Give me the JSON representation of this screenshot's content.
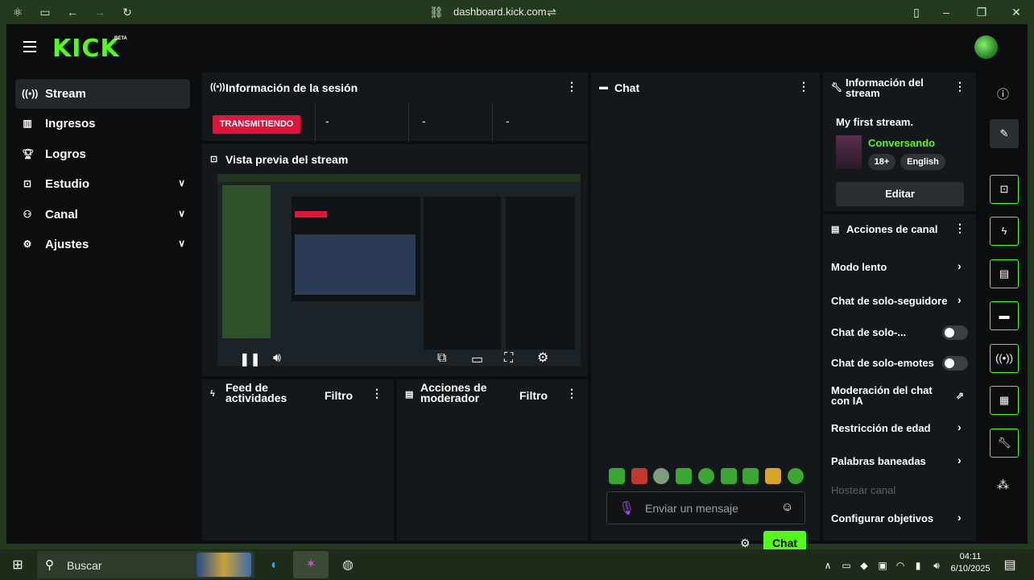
{
  "browser": {
    "url": "dashboard.kick.com"
  },
  "brand": {
    "logo": "KICK",
    "badge": "BETA",
    "accent": "#53fc18",
    "live_color": "#e0153e"
  },
  "sidebar": {
    "items": [
      {
        "label": "Stream",
        "icon": "broadcast-icon",
        "active": true
      },
      {
        "label": "Ingresos",
        "icon": "chart-icon"
      },
      {
        "label": "Logros",
        "icon": "trophy-icon"
      },
      {
        "label": "Estudio",
        "icon": "studio-icon",
        "expandable": true
      },
      {
        "label": "Canal",
        "icon": "channel-icon",
        "expandable": true
      },
      {
        "label": "Ajustes",
        "icon": "gear-icon",
        "expandable": true
      }
    ]
  },
  "session": {
    "title": "Información de la sesión",
    "status": "TRANSMITIENDO",
    "stats": [
      "-",
      "-",
      "-"
    ]
  },
  "preview": {
    "title": "Vista previa del stream"
  },
  "activity": {
    "title": "Feed de actividades",
    "filter": "Filtro"
  },
  "mod_actions": {
    "title": "Acciones de moderador",
    "filter": "Filtro"
  },
  "chat": {
    "title": "Chat",
    "placeholder": "Enviar un mensaje",
    "send": "Chat"
  },
  "stream_info": {
    "title": "Información del stream",
    "stream_title": "My first stream.",
    "category": "Conversando",
    "tags": [
      "18+",
      "English"
    ],
    "edit": "Editar"
  },
  "channel_actions": {
    "title": "Acciones de canal",
    "items": [
      {
        "label": "Modo lento",
        "control": "chevron"
      },
      {
        "label": "Chat de solo-seguidore",
        "control": "chevron"
      },
      {
        "label": "Chat de solo-...",
        "control": "toggle",
        "on": false
      },
      {
        "label": "Chat de solo-emotes",
        "control": "toggle",
        "on": false
      },
      {
        "label": "Moderación del chat con IA",
        "control": "external"
      },
      {
        "label": "Restricción de edad",
        "control": "chevron"
      },
      {
        "label": "Palabras baneadas",
        "control": "chevron"
      },
      {
        "label": "Hostear canal",
        "control": "none",
        "disabled": true
      },
      {
        "label": "Configurar objetivos",
        "control": "chevron"
      }
    ]
  },
  "taskbar": {
    "search": "Buscar",
    "time": "04:11",
    "date": "6/10/2025"
  }
}
